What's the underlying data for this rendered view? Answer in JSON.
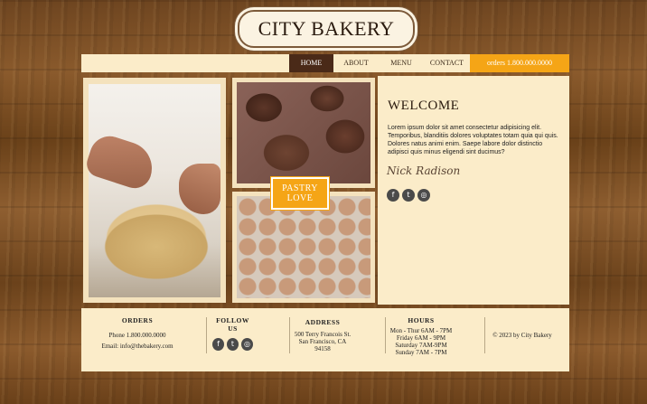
{
  "logo": {
    "text": "CITY BAKERY"
  },
  "nav": {
    "home": "HOME",
    "about": "ABOUT",
    "menu": "MENU",
    "contact": "CONTACT",
    "orders": "orders 1.800.000.0000"
  },
  "badge": {
    "line1": "PASTRY",
    "line2": "LOVE"
  },
  "welcome": {
    "title": "WELCOME",
    "body": "Lorem ipsum dolor sit amet consectetur adipisicing elit. Temporibus, blanditiis dolores voluptates totam quia qui quis. Dolores natus animi enim. Saepe labore dolor distinctio adipisci quis minus eligendi sint ducimus?",
    "signature": "Nick Radison"
  },
  "social_icons": [
    "facebook-icon",
    "twitter-icon",
    "instagram-icon"
  ],
  "footer": {
    "orders": {
      "heading": "ORDERS",
      "phone": "Phone 1.800.000.0000",
      "email": "Email: info@thebakery.com"
    },
    "follow": {
      "heading": "FOLLOW US"
    },
    "address": {
      "heading": "ADDRESS",
      "line1": "500 Terry Francois St.",
      "line2": "San Francisco, CA",
      "line3": "94158"
    },
    "hours": {
      "heading": "HOURS",
      "line1": "Mon - Thur 6AM - 7PM",
      "line2": "Friday 6AM - 9PM",
      "line3": "Saturday 7AM-9PM",
      "line4": "Sunday 7AM - 7PM"
    },
    "copyright": "© 2023 by City Bakery"
  },
  "colors": {
    "accent": "#f5a516",
    "nav_active": "#4a2a18",
    "panel": "#fbecc9"
  }
}
